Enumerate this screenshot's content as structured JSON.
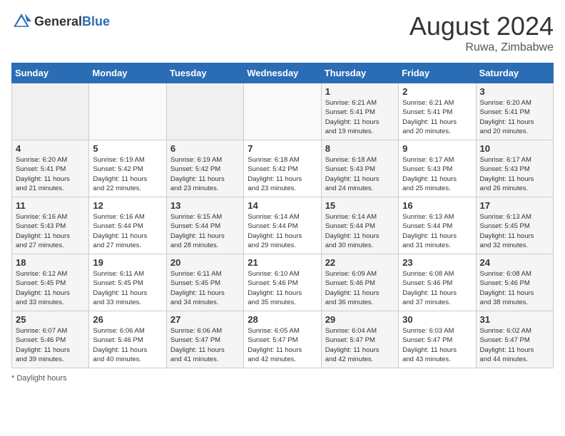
{
  "header": {
    "logo_general": "General",
    "logo_blue": "Blue",
    "month_year": "August 2024",
    "location": "Ruwa, Zimbabwe"
  },
  "days_of_week": [
    "Sunday",
    "Monday",
    "Tuesday",
    "Wednesday",
    "Thursday",
    "Friday",
    "Saturday"
  ],
  "footer": {
    "note": "Daylight hours"
  },
  "weeks": [
    [
      {
        "day": "",
        "info": ""
      },
      {
        "day": "",
        "info": ""
      },
      {
        "day": "",
        "info": ""
      },
      {
        "day": "",
        "info": ""
      },
      {
        "day": "1",
        "info": "Sunrise: 6:21 AM\nSunset: 5:41 PM\nDaylight: 11 hours\nand 19 minutes."
      },
      {
        "day": "2",
        "info": "Sunrise: 6:21 AM\nSunset: 5:41 PM\nDaylight: 11 hours\nand 20 minutes."
      },
      {
        "day": "3",
        "info": "Sunrise: 6:20 AM\nSunset: 5:41 PM\nDaylight: 11 hours\nand 20 minutes."
      }
    ],
    [
      {
        "day": "4",
        "info": "Sunrise: 6:20 AM\nSunset: 5:41 PM\nDaylight: 11 hours\nand 21 minutes."
      },
      {
        "day": "5",
        "info": "Sunrise: 6:19 AM\nSunset: 5:42 PM\nDaylight: 11 hours\nand 22 minutes."
      },
      {
        "day": "6",
        "info": "Sunrise: 6:19 AM\nSunset: 5:42 PM\nDaylight: 11 hours\nand 23 minutes."
      },
      {
        "day": "7",
        "info": "Sunrise: 6:18 AM\nSunset: 5:42 PM\nDaylight: 11 hours\nand 23 minutes."
      },
      {
        "day": "8",
        "info": "Sunrise: 6:18 AM\nSunset: 5:43 PM\nDaylight: 11 hours\nand 24 minutes."
      },
      {
        "day": "9",
        "info": "Sunrise: 6:17 AM\nSunset: 5:43 PM\nDaylight: 11 hours\nand 25 minutes."
      },
      {
        "day": "10",
        "info": "Sunrise: 6:17 AM\nSunset: 5:43 PM\nDaylight: 11 hours\nand 26 minutes."
      }
    ],
    [
      {
        "day": "11",
        "info": "Sunrise: 6:16 AM\nSunset: 5:43 PM\nDaylight: 11 hours\nand 27 minutes."
      },
      {
        "day": "12",
        "info": "Sunrise: 6:16 AM\nSunset: 5:44 PM\nDaylight: 11 hours\nand 27 minutes."
      },
      {
        "day": "13",
        "info": "Sunrise: 6:15 AM\nSunset: 5:44 PM\nDaylight: 11 hours\nand 28 minutes."
      },
      {
        "day": "14",
        "info": "Sunrise: 6:14 AM\nSunset: 5:44 PM\nDaylight: 11 hours\nand 29 minutes."
      },
      {
        "day": "15",
        "info": "Sunrise: 6:14 AM\nSunset: 5:44 PM\nDaylight: 11 hours\nand 30 minutes."
      },
      {
        "day": "16",
        "info": "Sunrise: 6:13 AM\nSunset: 5:44 PM\nDaylight: 11 hours\nand 31 minutes."
      },
      {
        "day": "17",
        "info": "Sunrise: 6:13 AM\nSunset: 5:45 PM\nDaylight: 11 hours\nand 32 minutes."
      }
    ],
    [
      {
        "day": "18",
        "info": "Sunrise: 6:12 AM\nSunset: 5:45 PM\nDaylight: 11 hours\nand 33 minutes."
      },
      {
        "day": "19",
        "info": "Sunrise: 6:11 AM\nSunset: 5:45 PM\nDaylight: 11 hours\nand 33 minutes."
      },
      {
        "day": "20",
        "info": "Sunrise: 6:11 AM\nSunset: 5:45 PM\nDaylight: 11 hours\nand 34 minutes."
      },
      {
        "day": "21",
        "info": "Sunrise: 6:10 AM\nSunset: 5:46 PM\nDaylight: 11 hours\nand 35 minutes."
      },
      {
        "day": "22",
        "info": "Sunrise: 6:09 AM\nSunset: 5:46 PM\nDaylight: 11 hours\nand 36 minutes."
      },
      {
        "day": "23",
        "info": "Sunrise: 6:08 AM\nSunset: 5:46 PM\nDaylight: 11 hours\nand 37 minutes."
      },
      {
        "day": "24",
        "info": "Sunrise: 6:08 AM\nSunset: 5:46 PM\nDaylight: 11 hours\nand 38 minutes."
      }
    ],
    [
      {
        "day": "25",
        "info": "Sunrise: 6:07 AM\nSunset: 5:46 PM\nDaylight: 11 hours\nand 39 minutes."
      },
      {
        "day": "26",
        "info": "Sunrise: 6:06 AM\nSunset: 5:46 PM\nDaylight: 11 hours\nand 40 minutes."
      },
      {
        "day": "27",
        "info": "Sunrise: 6:06 AM\nSunset: 5:47 PM\nDaylight: 11 hours\nand 41 minutes."
      },
      {
        "day": "28",
        "info": "Sunrise: 6:05 AM\nSunset: 5:47 PM\nDaylight: 11 hours\nand 42 minutes."
      },
      {
        "day": "29",
        "info": "Sunrise: 6:04 AM\nSunset: 5:47 PM\nDaylight: 11 hours\nand 42 minutes."
      },
      {
        "day": "30",
        "info": "Sunrise: 6:03 AM\nSunset: 5:47 PM\nDaylight: 11 hours\nand 43 minutes."
      },
      {
        "day": "31",
        "info": "Sunrise: 6:02 AM\nSunset: 5:47 PM\nDaylight: 11 hours\nand 44 minutes."
      }
    ]
  ]
}
